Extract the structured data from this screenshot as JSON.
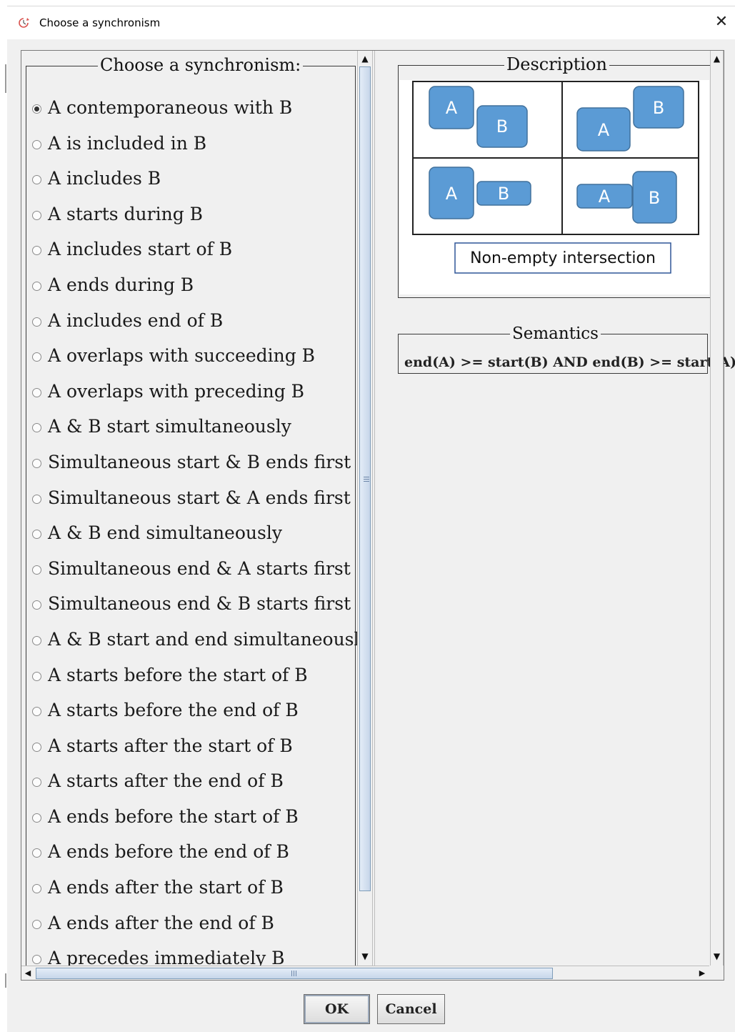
{
  "window": {
    "title": "Choose a synchronism",
    "close_glyph": "✕",
    "icon": "clock-arrow-icon"
  },
  "left": {
    "legend": "Choose a synchronism:",
    "options": [
      {
        "label": "A contemporaneous with B",
        "selected": true
      },
      {
        "label": "A is included in B",
        "selected": false
      },
      {
        "label": "A includes B",
        "selected": false
      },
      {
        "label": "A starts during B",
        "selected": false
      },
      {
        "label": "A includes start of B",
        "selected": false
      },
      {
        "label": "A ends during B",
        "selected": false
      },
      {
        "label": "A includes end of B",
        "selected": false
      },
      {
        "label": "A overlaps with succeeding B",
        "selected": false
      },
      {
        "label": "A overlaps with preceding B",
        "selected": false
      },
      {
        "label": "A & B start simultaneously",
        "selected": false
      },
      {
        "label": "Simultaneous start & B ends first",
        "selected": false
      },
      {
        "label": "Simultaneous start & A ends first",
        "selected": false
      },
      {
        "label": "A & B end simultaneously",
        "selected": false
      },
      {
        "label": "Simultaneous end & A starts first",
        "selected": false
      },
      {
        "label": "Simultaneous end & B starts first",
        "selected": false
      },
      {
        "label": "A & B start and end simultaneously",
        "selected": false
      },
      {
        "label": "A starts before the start of B",
        "selected": false
      },
      {
        "label": "A starts before the end of B",
        "selected": false
      },
      {
        "label": "A starts after the start of B",
        "selected": false
      },
      {
        "label": "A starts after the end of B",
        "selected": false
      },
      {
        "label": "A ends before the start of B",
        "selected": false
      },
      {
        "label": "A ends before the end of B",
        "selected": false
      },
      {
        "label": "A ends after the start of B",
        "selected": false
      },
      {
        "label": "A ends after the end of B",
        "selected": false
      },
      {
        "label": "A precedes immediately B",
        "selected": false
      }
    ]
  },
  "right": {
    "description_legend": "Description",
    "diagram": {
      "label_a": "A",
      "label_b": "B",
      "caption": "Non-empty intersection",
      "box_color": "#5b9bd5",
      "box_border": "#41719c"
    },
    "semantics_legend": "Semantics",
    "semantics_text": "end(A) >= start(B)  AND  end(B) >= start(A)"
  },
  "buttons": {
    "ok": "OK",
    "cancel": "Cancel"
  },
  "colors": {
    "dialog_bg": "#f0f0f0",
    "scroll_thumb": "#c7d6ea"
  }
}
